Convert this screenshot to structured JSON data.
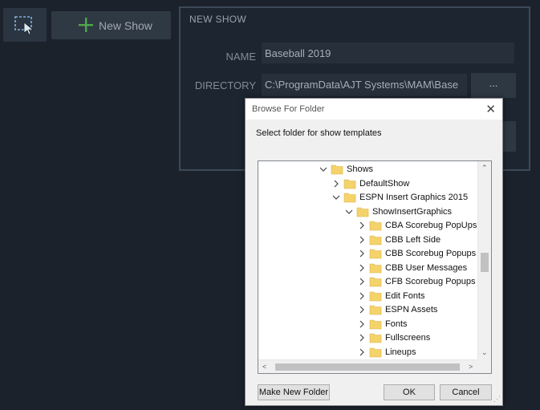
{
  "toolbar": {
    "select_icon": "selection-cursor-icon",
    "new_show_icon": "plus-icon",
    "new_show_label": "New Show"
  },
  "panel": {
    "title": "NEW SHOW",
    "name_label": "NAME",
    "name_value": "Baseball 2019",
    "directory_label": "DIRECTORY",
    "directory_value": "C:\\ProgramData\\AJT Systems\\MAM\\Base",
    "browse_label": "..."
  },
  "dialog": {
    "title": "Browse For Folder",
    "description": "Select folder for show templates",
    "tree": [
      {
        "label": "Shows",
        "state": "expanded"
      },
      {
        "label": "DefaultShow",
        "state": "collapsed"
      },
      {
        "label": "ESPN Insert Graphics 2015",
        "state": "expanded",
        "selected": true
      },
      {
        "label": "ShowInsertGraphics",
        "state": "expanded"
      },
      {
        "label": "CBA Scorebug PopUps",
        "state": "collapsed"
      },
      {
        "label": "CBB Left Side",
        "state": "collapsed"
      },
      {
        "label": "CBB Scorebug Popups",
        "state": "collapsed"
      },
      {
        "label": "CBB User Messages",
        "state": "collapsed"
      },
      {
        "label": "CFB Scorebug Popups",
        "state": "collapsed"
      },
      {
        "label": "Edit Fonts",
        "state": "collapsed"
      },
      {
        "label": "ESPN Assets",
        "state": "collapsed"
      },
      {
        "label": "Fonts",
        "state": "collapsed"
      },
      {
        "label": "Fullscreens",
        "state": "collapsed"
      },
      {
        "label": "Lineups",
        "state": "collapsed"
      }
    ],
    "make_new_folder_label": "Make New Folder",
    "ok_label": "OK",
    "cancel_label": "Cancel"
  },
  "colors": {
    "background": "#1b222c",
    "accent_green": "#4fa84a",
    "folder_yellow": "#f5d36b",
    "tree_selection": "#d9d9d9"
  }
}
